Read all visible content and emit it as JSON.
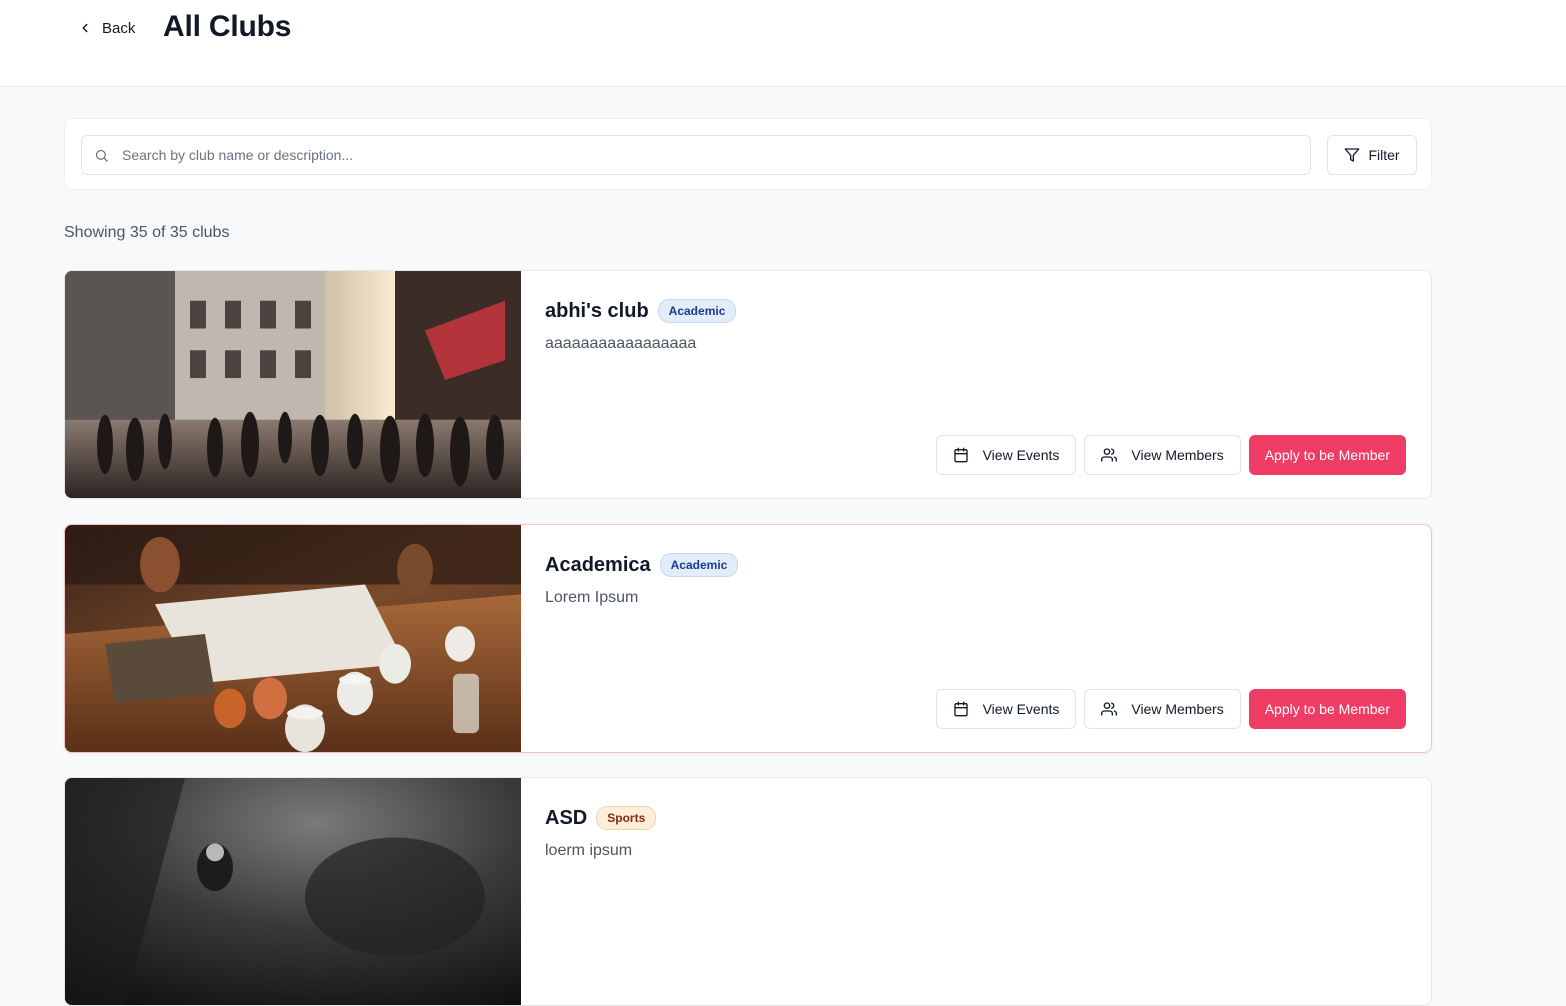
{
  "header": {
    "back_label": "Back",
    "title": "All Clubs"
  },
  "search": {
    "placeholder": "Search by club name or description...",
    "value": "",
    "filter_label": "Filter"
  },
  "results": {
    "count_text": "Showing 35 of 35 clubs"
  },
  "actions": {
    "view_events_label": "View Events",
    "view_members_label": "View Members",
    "apply_label": "Apply to be Member"
  },
  "clubs": [
    {
      "name": "abhi's club",
      "category": "Academic",
      "description": "aaaaaaaaaaaaaaaaa",
      "image": "city-street-crowd-photo"
    },
    {
      "name": "Academica",
      "category": "Academic",
      "description": "Lorem Ipsum",
      "image": "table-with-cups-photo"
    },
    {
      "name": "ASD",
      "category": "Sports",
      "description": "loerm ipsum",
      "image": "dark-underwater-diver-photo"
    }
  ],
  "colors": {
    "primary": "#ef3c64",
    "academic_badge_bg": "#e3ecfb",
    "academic_badge_text": "#1e3a8a",
    "sports_badge_bg": "#fdedd9",
    "sports_badge_text": "#7c2d12"
  },
  "icons": {
    "back": "chevron-left-icon",
    "search": "search-icon",
    "filter": "filter-icon",
    "events": "calendar-icon",
    "members": "users-icon"
  }
}
